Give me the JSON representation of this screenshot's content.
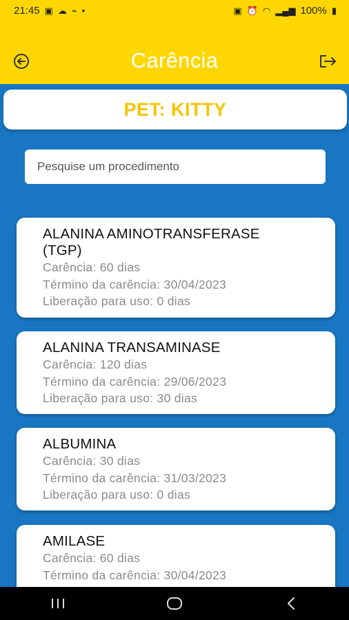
{
  "status_bar": {
    "time": "21:45",
    "battery": "100%"
  },
  "header": {
    "title": "Carência"
  },
  "pet": {
    "label": "PET: KITTY"
  },
  "search": {
    "placeholder": "Pesquise um procedimento",
    "value": ""
  },
  "procedures": [
    {
      "name_line1": "ALANINA AMINOTRANSFERASE",
      "name_line2": "(TGP)",
      "carencia": "Carência: 60 dias",
      "termino": "Término da carência: 30/04/2023",
      "liberacao": "Liberação para uso: 0 dias"
    },
    {
      "name_line1": "ALANINA TRANSAMINASE",
      "carencia": "Carência: 120 dias",
      "termino": "Término da carência: 29/06/2023",
      "liberacao": "Liberação para uso: 30 dias"
    },
    {
      "name_line1": "ALBUMINA",
      "carencia": "Carência: 30 dias",
      "termino": "Término da carência: 31/03/2023",
      "liberacao": "Liberação para uso: 0 dias"
    },
    {
      "name_line1": "AMILASE",
      "carencia": "Carência: 60 dias",
      "termino": "Término da carência: 30/04/2023"
    }
  ],
  "icons": {
    "back": "back-circle-arrow-icon",
    "exit": "logout-icon",
    "nav_recents": "recents-icon",
    "nav_home": "home-icon",
    "nav_back": "back-chevron-icon"
  },
  "colors": {
    "primary_yellow": "#fed702",
    "background_blue": "#1976c2",
    "pet_text": "#f5c400"
  }
}
